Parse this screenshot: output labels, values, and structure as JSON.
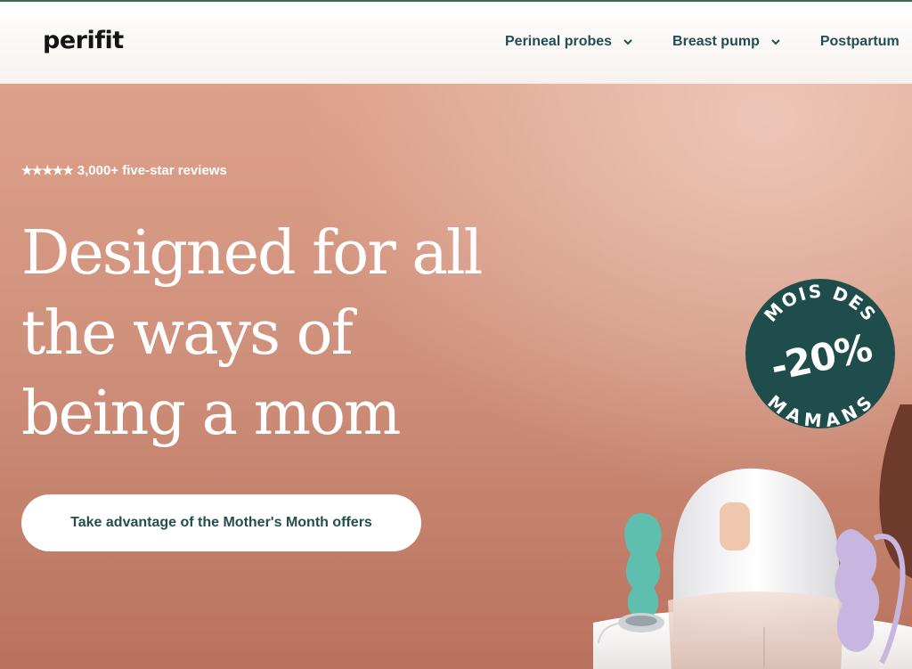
{
  "brand": {
    "logo_text": "perifit"
  },
  "nav": {
    "items": [
      {
        "label": "Perineal probes"
      },
      {
        "label": "Breast pump"
      },
      {
        "label": "Postpartum"
      }
    ]
  },
  "hero": {
    "stars": "★★★★★",
    "reviews_text": "3,000+ five-star reviews",
    "headline_lines": [
      "Designed for all",
      "the ways of",
      "being a mom"
    ],
    "cta_label": "Take advantage of the Mother's Month offers"
  },
  "badge": {
    "top_text": "MOIS DES",
    "discount": "-20%",
    "bottom_text": "MAMANS"
  },
  "colors": {
    "accent": "#224f4d",
    "badge": "#1f4d4c",
    "hero_bg": "#d4947f",
    "teal_probe": "#5fbfae",
    "lilac_probe": "#c6b6e0"
  }
}
